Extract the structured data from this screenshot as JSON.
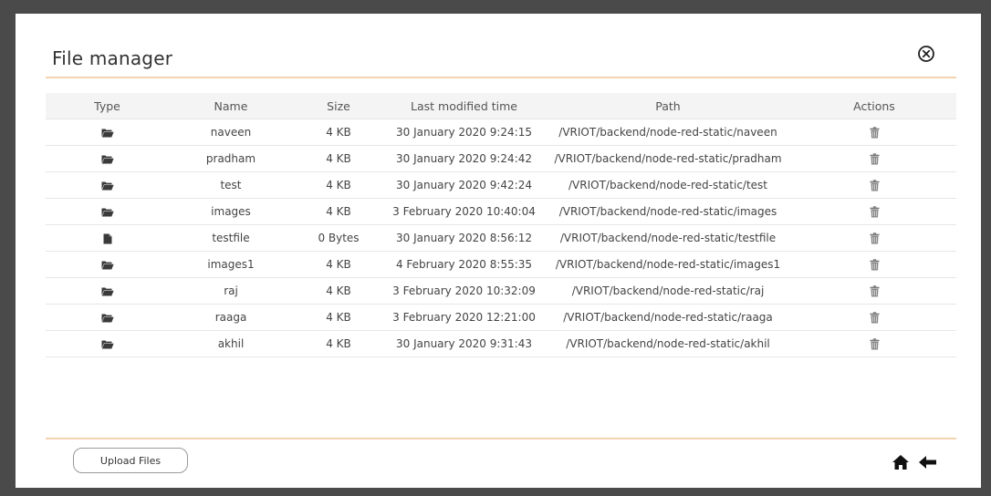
{
  "modal": {
    "title": "File manager",
    "close_icon": "close-circle-icon"
  },
  "table": {
    "columns": [
      "Type",
      "Name",
      "Size",
      "Last modified time",
      "Path",
      "Actions"
    ],
    "rows": [
      {
        "type": "folder",
        "name": "naveen",
        "size": "4 KB",
        "modified": "30 January 2020 9:24:15",
        "path": "/VRIOT/backend/node-red-static/naveen"
      },
      {
        "type": "folder",
        "name": "pradham",
        "size": "4 KB",
        "modified": "30 January 2020 9:24:42",
        "path": "/VRIOT/backend/node-red-static/pradham"
      },
      {
        "type": "folder",
        "name": "test",
        "size": "4 KB",
        "modified": "30 January 2020 9:42:24",
        "path": "/VRIOT/backend/node-red-static/test"
      },
      {
        "type": "folder",
        "name": "images",
        "size": "4 KB",
        "modified": "3 February 2020 10:40:04",
        "path": "/VRIOT/backend/node-red-static/images"
      },
      {
        "type": "file",
        "name": "testfile",
        "size": "0 Bytes",
        "modified": "30 January 2020 8:56:12",
        "path": "/VRIOT/backend/node-red-static/testfile"
      },
      {
        "type": "folder",
        "name": "images1",
        "size": "4 KB",
        "modified": "4 February 2020 8:55:35",
        "path": "/VRIOT/backend/node-red-static/images1"
      },
      {
        "type": "folder",
        "name": "raj",
        "size": "4 KB",
        "modified": "3 February 2020 10:32:09",
        "path": "/VRIOT/backend/node-red-static/raj"
      },
      {
        "type": "folder",
        "name": "raaga",
        "size": "4 KB",
        "modified": "3 February 2020 12:21:00",
        "path": "/VRIOT/backend/node-red-static/raaga"
      },
      {
        "type": "folder",
        "name": "akhil",
        "size": "4 KB",
        "modified": "30 January 2020 9:31:43",
        "path": "/VRIOT/backend/node-red-static/akhil"
      }
    ],
    "action_icon": "trash-icon"
  },
  "footer": {
    "upload_label": "Upload Files",
    "home_icon": "home-icon",
    "back_icon": "arrow-left-icon"
  },
  "colors": {
    "overlay": "#4a4a4a",
    "accent_rule": "#f3d3b0",
    "header_bg": "#f4f4f4"
  }
}
